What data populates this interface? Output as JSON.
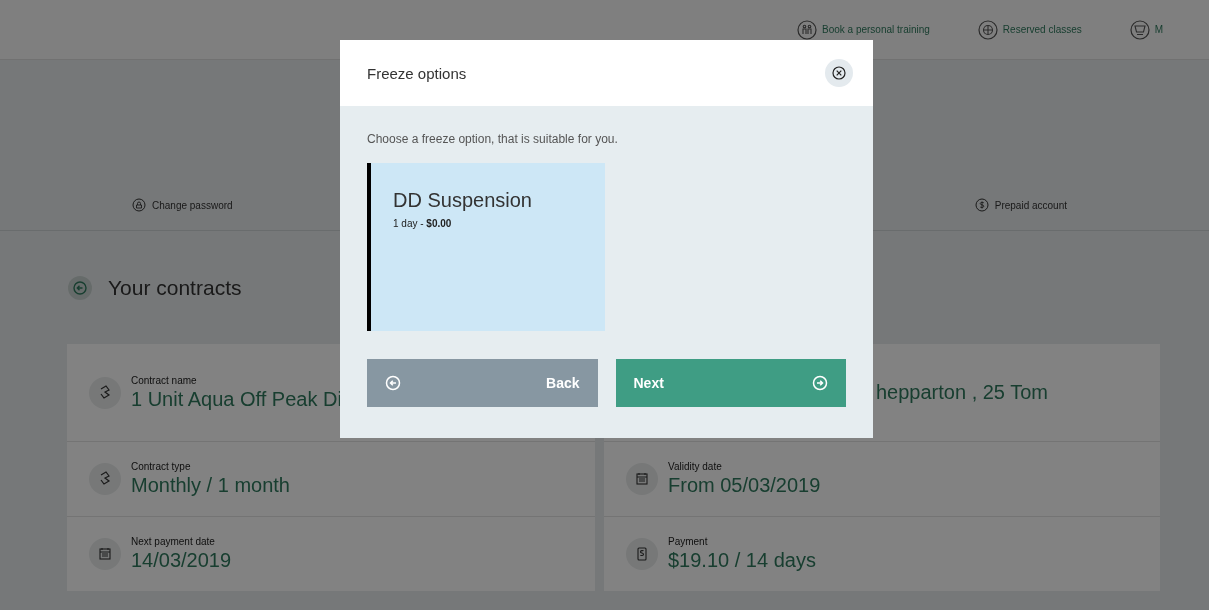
{
  "top_nav": [
    {
      "label": "Book a personal training"
    },
    {
      "label": "Reserved classes"
    },
    {
      "label": "M"
    }
  ],
  "account_nav": [
    {
      "label": "Change password"
    },
    {
      "label": "Prepaid account"
    }
  ],
  "section": {
    "title": "Your contracts"
  },
  "contract_fields": [
    {
      "kind": "name",
      "label": "Contract name",
      "value": "1 Unit Aqua Off Peak Di"
    },
    {
      "kind": "location",
      "value": "hepparton , 25 Tom"
    },
    {
      "kind": "type",
      "label": "Contract type",
      "value": "Monthly / 1 month"
    },
    {
      "kind": "date",
      "label": "Validity date",
      "value": "From 05/03/2019"
    },
    {
      "kind": "date",
      "label": "Next payment date",
      "value": "14/03/2019"
    },
    {
      "kind": "payment",
      "label": "Payment",
      "value": "$19.10 / 14 days"
    }
  ],
  "modal": {
    "title": "Freeze options",
    "intro": "Choose a freeze option, that is suitable for you.",
    "options": [
      {
        "name": "DD Suspension",
        "detail": "1 day - **$0.00**",
        "selected": true
      }
    ],
    "buttons": [
      {
        "kind": "back",
        "label": "Back"
      },
      {
        "kind": "next",
        "label": "Next"
      }
    ]
  }
}
